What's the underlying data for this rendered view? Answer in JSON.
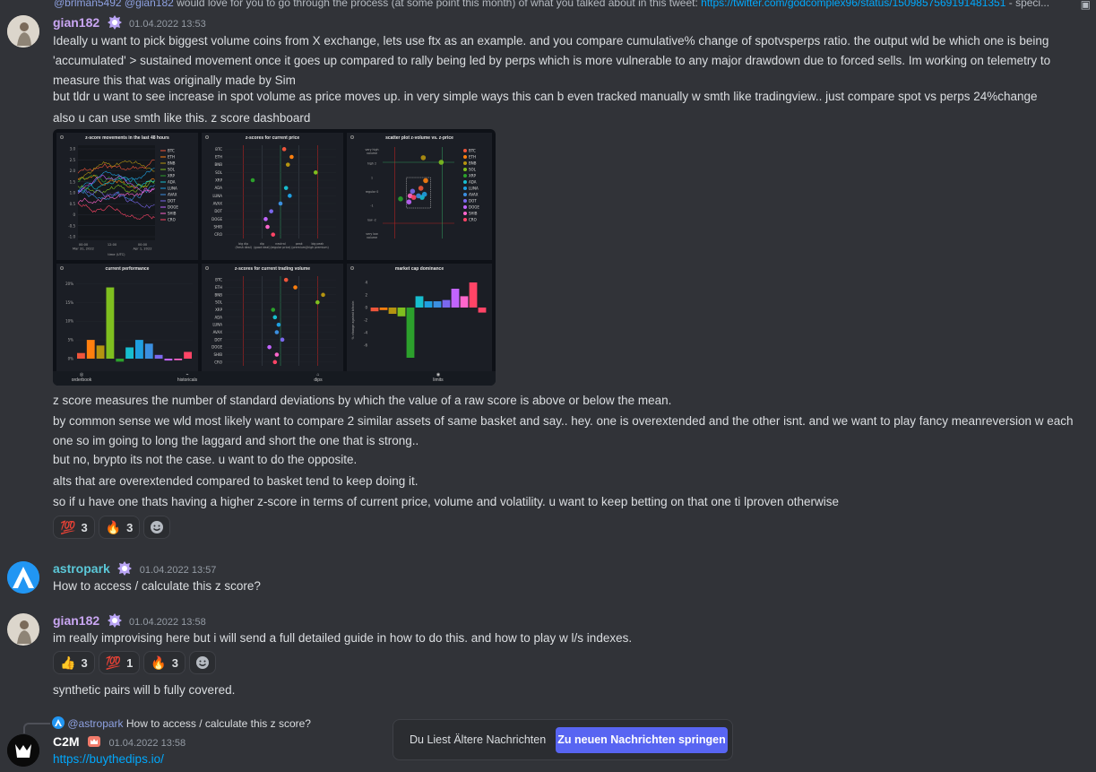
{
  "top_reply": {
    "author": "@brlman5492",
    "mention": "@gian182",
    "text": "would love for you to go through the process  (at some point this month) of what you talked about in this tweet:",
    "link": "https://twitter.com/godcomplex96/status/1509857569191481351",
    "suffix": "- speci..."
  },
  "messages": {
    "m1": {
      "username": "gian182",
      "username_color": "#c9a6f2",
      "timestamp": "01.04.2022 13:53",
      "lines": [
        "Ideally u want to pick biggest volume coins from X exchange, lets use ftx as an example. and you compare cumulative% change of spotvsperps ratio. the output wld be which one is being 'accumulated' > sustained movement once it goes up compared to rally being led by perps which is more vulnerable to any major drawdown due to forced sells. Im working on telemetry to measure this that was originally made by Sim",
        "but tldr u want to see increase in spot volume as price moves up. in very simple ways this can b even tracked manually w smth like tradingview.. just compare spot vs perps 24%change",
        "also u can use smth like this. z score dashboard"
      ],
      "after_lines": [
        "z score measures the number of standard deviations by which the value of a raw score is above or below the mean.",
        "by common sense we wld most likely want to compare 2 similar assets of same basket and say.. hey. one is overextended and the other isnt. and we want to play fancy meanreversion w each one so im going to long the laggard and short the one that is strong..",
        "but no, brypto its not the case. u want to do the opposite.",
        "alts that are overextended compared to basket tend to keep doing it.",
        "so if u have one thats having a higher z-score in terms of current price, volume and volatility. u want to keep betting on that one ti lproven otherwise"
      ],
      "reactions": [
        {
          "emoji": "💯",
          "count": "3"
        },
        {
          "emoji": "🔥",
          "count": "3"
        }
      ]
    },
    "m2": {
      "username": "astropark",
      "username_color": "#5bc8d8",
      "timestamp": "01.04.2022 13:57",
      "text": "How to access / calculate this z score?"
    },
    "m3": {
      "username": "gian182",
      "username_color": "#c9a6f2",
      "timestamp": "01.04.2022 13:58",
      "text": "im really improvising here but i will send a full detailed guide in how to do this. and how to play w l/s indexes.",
      "reactions": [
        {
          "emoji": "👍",
          "count": "3"
        },
        {
          "emoji": "💯",
          "count": "1"
        },
        {
          "emoji": "🔥",
          "count": "3"
        }
      ],
      "followup": "synthetic pairs will b fully covered."
    },
    "m4": {
      "reply_mention": "@astropark",
      "reply_text": "How to access / calculate this z score?",
      "username": "C2M",
      "username_color": "#ffffff",
      "timestamp": "01.04.2022 13:58",
      "link": "https://buythedips.io/"
    }
  },
  "dashboard": {
    "panel_titles": [
      "z-score movements in the last 48 hours",
      "z-scores for current price",
      "scatter plot z-volume vs. z-price",
      "current performance",
      "z-scores for current trading volume",
      "market cap dominance"
    ],
    "coins": [
      "BTC",
      "ETH",
      "BNB",
      "SOL",
      "XRP",
      "ADA",
      "LUNA",
      "AVAX",
      "DOT",
      "DOGE",
      "SHIB",
      "CRO"
    ],
    "coin_colors": [
      "#ef553b",
      "#ff7f0e",
      "#b59410",
      "#7fbf1f",
      "#2ca02c",
      "#17becf",
      "#1f9fe0",
      "#3b8fe0",
      "#7b68ee",
      "#c264fe",
      "#ff66cc",
      "#ff4466"
    ],
    "line_y_ticks": [
      "3.0",
      "2.5",
      "2.0",
      "1.5",
      "1.0",
      "0.5",
      "0",
      "-0.5",
      "-1.0"
    ],
    "line_x_ticks": [
      "00:00\nMar 31, 2022",
      "12:00",
      "00:00\nApr 1, 2022"
    ],
    "line_x_label": "time (UTC)",
    "price_x_labels": [
      "big dip\n(fresh deal)",
      "dip\n(good deal)",
      "neutral\n(regular price)",
      "peak\n(premium)",
      "big peak\n(high premium)"
    ],
    "scatter_y_labels": [
      "very high\nvolume",
      "high 2",
      "1",
      "regular 0",
      "-1",
      "low -2",
      "very low\nvolume"
    ],
    "perf_y_ticks": [
      "20%",
      "15%",
      "10%",
      "5%",
      "0%"
    ],
    "dom_y_label": "% change against bitcoin",
    "dom_y_ticks": [
      "4",
      "2",
      "0",
      "-2",
      "-4",
      "-6"
    ],
    "tabs": [
      "orderbook",
      "historicals",
      "dips",
      "limits"
    ],
    "price_z": [
      0.2,
      0.6,
      0.4,
      1.9,
      -1.5,
      0.3,
      0.5,
      0.0,
      -0.5,
      -0.8,
      -0.7,
      -0.4
    ],
    "volume_z": [
      0.3,
      0.8,
      2.3,
      2.0,
      -0.4,
      -0.3,
      -0.1,
      -0.2,
      0.1,
      -0.6,
      -0.2,
      -0.3
    ],
    "performance": [
      1.5,
      5.0,
      3.5,
      19.0,
      -0.8,
      3.0,
      5.0,
      4.0,
      1.0,
      -0.5,
      -0.4,
      1.8
    ],
    "dominance": [
      -0.6,
      -0.4,
      -1.0,
      -1.4,
      -8.0,
      1.8,
      1.0,
      1.0,
      1.2,
      3.0,
      1.8,
      4.0,
      -0.8
    ]
  },
  "jump_bar": {
    "text": "Du Liest Ältere Nachrichten",
    "button": "Zu neuen Nachrichten springen"
  }
}
